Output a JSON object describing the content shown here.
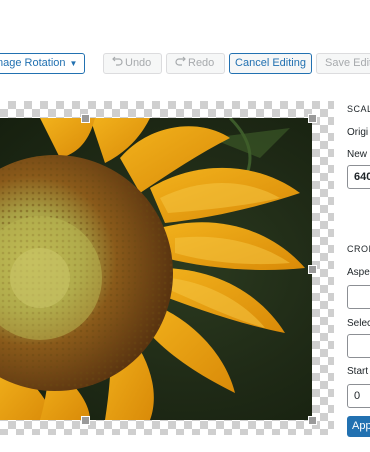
{
  "toolbar": {
    "rotation_label": "nage Rotation",
    "undo_label": "Undo",
    "redo_label": "Redo",
    "cancel_label": "Cancel Editing",
    "save_label": "Save Edits"
  },
  "side": {
    "scale_heading": "SCAL",
    "original_label": "Origi",
    "new_label": "New",
    "new_width_value": "640",
    "crop_heading": "CROI",
    "aspect_label": "Aspe",
    "selection_label": "Selec",
    "start_label": "Start",
    "start_value": "0",
    "apply_label": "Apply"
  },
  "icons": [
    "undo-icon",
    "redo-icon",
    "caret-down-icon"
  ]
}
